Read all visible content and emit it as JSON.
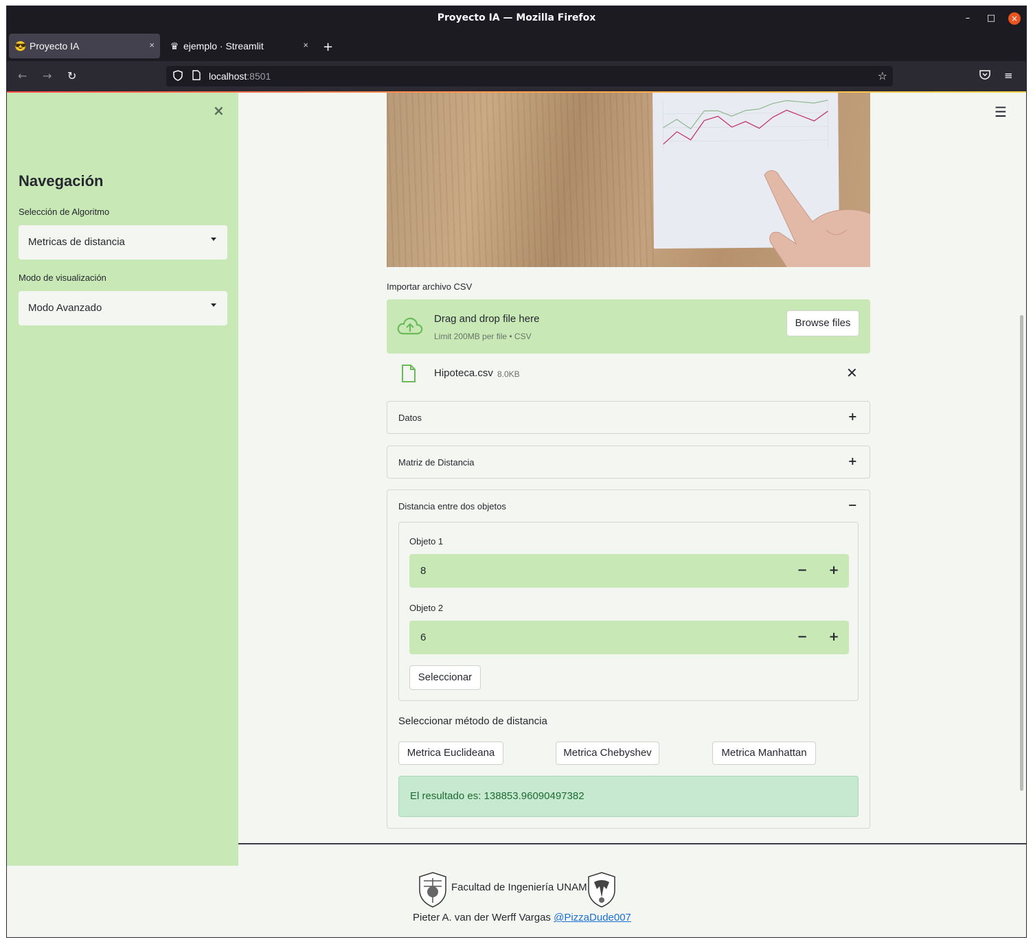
{
  "window": {
    "title": "Proyecto IA — Mozilla Firefox",
    "min_glyph": "–",
    "max_glyph": "□",
    "close_glyph": "×"
  },
  "tabs": [
    {
      "label": "Proyecto IA",
      "icon": "😎",
      "close": "×"
    },
    {
      "label": "ejemplo · Streamlit",
      "icon": "♛",
      "close": "×"
    }
  ],
  "newtab_glyph": "+",
  "nav": {
    "back_glyph": "←",
    "forward_glyph": "→",
    "reload_glyph": "↻",
    "url_host": "localhost",
    "url_port": ":8501",
    "star_glyph": "☆",
    "pocket_glyph": "◙",
    "menu_glyph": "≡"
  },
  "sidebar": {
    "close_glyph": "×",
    "heading": "Navegación",
    "algo_label": "Selección de Algoritmo",
    "algo_value": "Metricas de distancia",
    "mode_label": "Modo de visualización",
    "mode_value": "Modo Avanzado"
  },
  "main": {
    "menu_glyph": "☰",
    "import_label": "Importar archivo CSV",
    "dropzone": {
      "title": "Drag and drop file here",
      "limit": "Limit 200MB per file • CSV",
      "browse": "Browse files"
    },
    "file": {
      "name": "Hipoteca.csv",
      "size": "8.0KB",
      "remove_glyph": "✕"
    },
    "expanders": [
      {
        "label": "Datos",
        "sign": "+"
      },
      {
        "label": "Matriz de Distancia",
        "sign": "+"
      },
      {
        "label": "Distancia entre dos objetos",
        "sign": "−"
      }
    ],
    "form": {
      "obj1_label": "Objeto 1",
      "obj1_value": "8",
      "obj2_label": "Objeto 2",
      "obj2_value": "6",
      "minus": "−",
      "plus": "+",
      "select_btn": "Seleccionar"
    },
    "method_title": "Seleccionar método de distancia",
    "methods": [
      "Metrica Euclideana",
      "Metrica Chebyshev",
      "Metrica Manhattan"
    ],
    "result": "El resultado es: 138853.96090497382"
  },
  "footer": {
    "faculty": "Facultad de Ingeniería UNAM",
    "author": "Pieter A. van der Werff Vargas",
    "handle": "@PizzaDude007"
  },
  "colors": {
    "sidebar_bg": "#c8e9b6",
    "main_bg": "#f4f6f1",
    "success_bg": "#c6e9d0",
    "link": "#1a6fd6"
  }
}
